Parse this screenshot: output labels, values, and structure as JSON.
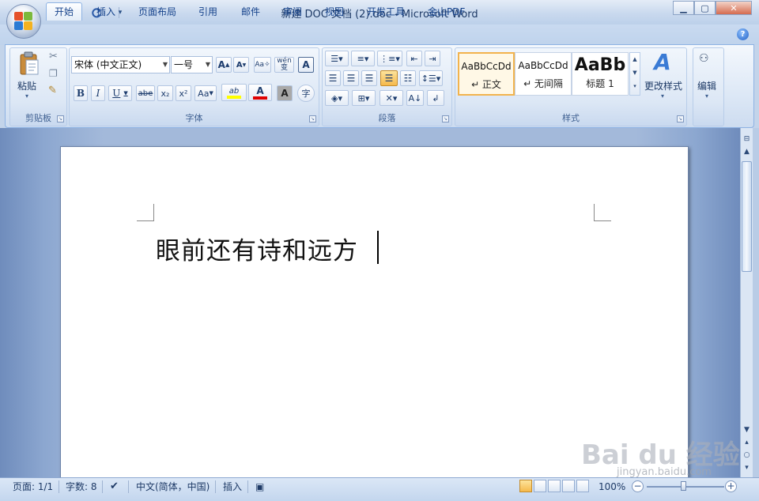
{
  "window": {
    "title": "新建 DOC 文档 (2).doc - Microsoft Word"
  },
  "qat": {
    "save_icon": "save-icon",
    "undo_icon": "undo-icon",
    "redo_icon": "redo-icon",
    "customize_icon": "chevron-down-icon"
  },
  "window_controls": {
    "minimize": "▁",
    "maximize": "▢",
    "close": "✕"
  },
  "tabs": [
    {
      "label": "开始",
      "active": true
    },
    {
      "label": "插入"
    },
    {
      "label": "页面布局"
    },
    {
      "label": "引用"
    },
    {
      "label": "邮件"
    },
    {
      "label": "审阅"
    },
    {
      "label": "视图"
    },
    {
      "label": "开发工具"
    },
    {
      "label": "金山PDF"
    }
  ],
  "help": {
    "label": "?"
  },
  "clipboard": {
    "paste": "粘贴",
    "group": "剪贴板"
  },
  "font": {
    "family": "宋体 (中文正文)",
    "size": "一号",
    "grow": "A",
    "shrink": "A",
    "bold": "B",
    "italic": "I",
    "underline": "U",
    "strike": "abe",
    "subscript": "x₂",
    "superscript": "x²",
    "change_case": "Aa",
    "highlight": "ab",
    "font_color": "A",
    "char_shading": "A",
    "enclose": "字",
    "phonetic": "wén",
    "phonetic_char": "变",
    "char_border": "A",
    "group": "字体"
  },
  "paragraph": {
    "group": "段落"
  },
  "styles": {
    "items": [
      {
        "sample": "AaBbCcDd",
        "name": "↵ 正文",
        "selected": true
      },
      {
        "sample": "AaBbCcDd",
        "name": "↵ 无间隔"
      },
      {
        "sample": "AaBb",
        "name": "标题 1"
      }
    ],
    "change": "更改样式",
    "group": "样式"
  },
  "editing": {
    "label": "编辑"
  },
  "document": {
    "text": "眼前还有诗和远方"
  },
  "statusbar": {
    "page": "页面: 1/1",
    "words": "字数: 8",
    "language": "中文(简体，中国)",
    "mode": "插入",
    "zoom": "100%",
    "zoom_out": "−",
    "zoom_in": "+"
  },
  "watermark": {
    "text": "Bai du 经验",
    "sub": "jingyan.baidu.com"
  },
  "colors": {
    "highlight": "#ffff00",
    "font_color": "#e00000",
    "accent": "#15428b"
  }
}
